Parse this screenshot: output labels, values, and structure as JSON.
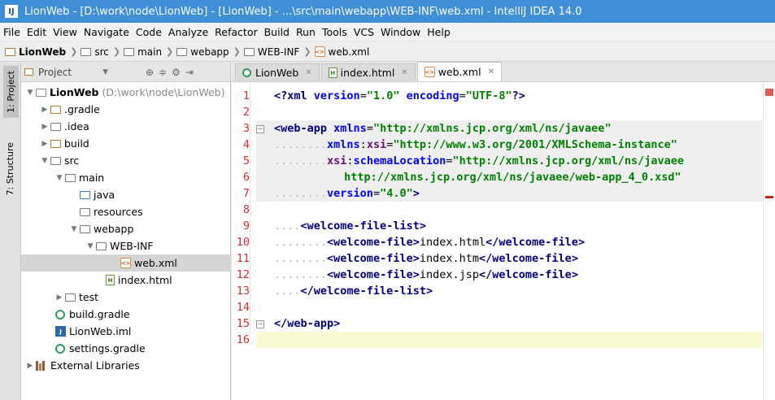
{
  "window": {
    "title": "LionWeb - [D:\\work\\node\\LionWeb] - [LionWeb] - ...\\src\\main\\webapp\\WEB-INF\\web.xml - IntelliJ IDEA 14.0"
  },
  "menu": [
    "File",
    "Edit",
    "View",
    "Navigate",
    "Code",
    "Analyze",
    "Refactor",
    "Build",
    "Run",
    "Tools",
    "VCS",
    "Window",
    "Help"
  ],
  "breadcrumbs": [
    "LionWeb",
    "src",
    "main",
    "webapp",
    "WEB-INF",
    "web.xml"
  ],
  "tool_strip": {
    "project_tab": "1: Project",
    "structure_tab": "7: Structure"
  },
  "project_panel": {
    "title": "Project"
  },
  "tree": [
    {
      "label": "LionWeb",
      "hint": "(D:\\work\\node\\LionWeb)"
    },
    {
      "label": ".gradle"
    },
    {
      "label": ".idea"
    },
    {
      "label": "build"
    },
    {
      "label": "src"
    },
    {
      "label": "main"
    },
    {
      "label": "java"
    },
    {
      "label": "resources"
    },
    {
      "label": "webapp"
    },
    {
      "label": "WEB-INF"
    },
    {
      "label": "web.xml"
    },
    {
      "label": "index.html"
    },
    {
      "label": "test"
    },
    {
      "label": "build.gradle"
    },
    {
      "label": "LionWeb.iml"
    },
    {
      "label": "settings.gradle"
    },
    {
      "label": "External Libraries"
    }
  ],
  "tabs": [
    "LionWeb",
    "index.html",
    "web.xml"
  ],
  "line_numbers": [
    "1",
    "2",
    "3",
    "4",
    "5",
    "6",
    "7",
    "8",
    "9",
    "10",
    "11",
    "12",
    "13",
    "14",
    "15",
    "16"
  ],
  "code": {
    "l1": [
      "<?",
      "xml",
      " version",
      "=",
      "\"1.0\"",
      " encoding",
      "=",
      "\"UTF-8\"",
      "?>"
    ],
    "l3": [
      "<",
      "web-app",
      " xmlns",
      "=",
      "\"http://xmlns.jcp.org/xml/ns/javaee\""
    ],
    "l4": [
      "xmlns",
      ":",
      "xsi",
      "=",
      "\"http://www.w3.org/2001/XMLSchema-instance\""
    ],
    "l5": [
      "xsi",
      ":",
      "schemaLocation",
      "=",
      "\"http://xmlns.jcp.org/xml/ns/javaee"
    ],
    "l6": [
      " http://xmlns.jcp.org/xml/ns/javaee/web-app_4_0.xsd\""
    ],
    "l7": [
      "version",
      "=",
      "\"4.0\"",
      ">"
    ],
    "l9": [
      "<",
      "welcome-file-list",
      ">"
    ],
    "l10": [
      "<",
      "welcome-file",
      ">",
      "index.html",
      "</",
      "welcome-file",
      ">"
    ],
    "l11": [
      "<",
      "welcome-file",
      ">",
      "index.htm",
      "</",
      "welcome-file",
      ">"
    ],
    "l12": [
      "<",
      "welcome-file",
      ">",
      "index.jsp",
      "</",
      "welcome-file",
      ">"
    ],
    "l13": [
      "</",
      "welcome-file-list",
      ">"
    ],
    "l15": [
      "</",
      "web-app",
      ">"
    ]
  },
  "leaders": {
    "l4": "........",
    "l5": "........",
    "l7": "........",
    "l9": "....",
    "l10": "........",
    "l11": "........",
    "l12": "........",
    "l13": "...."
  },
  "colors": {
    "titlebar": "#3f8fd7",
    "line_numbers": "#c83232",
    "tag": "#000080",
    "attribute": "#0000ff",
    "value": "#008000"
  }
}
